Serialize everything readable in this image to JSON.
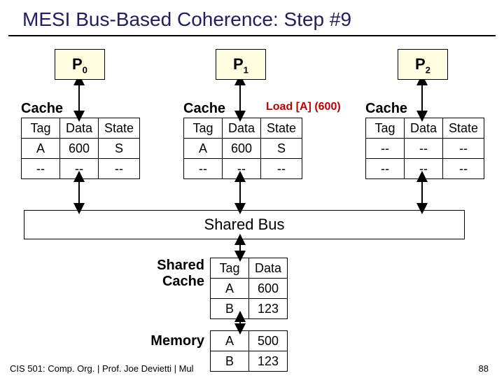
{
  "title": "MESI Bus-Based Coherence: Step #9",
  "processors": {
    "p0": "P",
    "p0s": "0",
    "p1": "P",
    "p1s": "1",
    "p2": "P",
    "p2s": "2"
  },
  "annotation": "Load [A] (600)",
  "cache_label": "Cache",
  "headers": {
    "tag": "Tag",
    "data": "Data",
    "state": "State"
  },
  "c0": {
    "r0": {
      "tag": "A",
      "data": "600",
      "state": "S"
    },
    "r1": {
      "tag": "--",
      "data": "--",
      "state": "--"
    }
  },
  "c1": {
    "r0": {
      "tag": "A",
      "data": "600",
      "state": "S"
    },
    "r1": {
      "tag": "--",
      "data": "--",
      "state": "--"
    }
  },
  "c2": {
    "r0": {
      "tag": "--",
      "data": "--",
      "state": "--"
    },
    "r1": {
      "tag": "--",
      "data": "--",
      "state": "--"
    }
  },
  "bus_label": "Shared Bus",
  "shared_cache_label_l1": "Shared",
  "shared_cache_label_l2": "Cache",
  "memory_label": "Memory",
  "shared_cache": {
    "h": {
      "tag": "Tag",
      "data": "Data"
    },
    "r0": {
      "tag": "A",
      "data": "600"
    },
    "r1": {
      "tag": "B",
      "data": "123"
    }
  },
  "memory": {
    "r0": {
      "tag": "A",
      "data": "500"
    },
    "r1": {
      "tag": "B",
      "data": "123"
    }
  },
  "footer": "CIS 501: Comp. Org. | Prof. Joe Devietti | Mul",
  "page": "88"
}
